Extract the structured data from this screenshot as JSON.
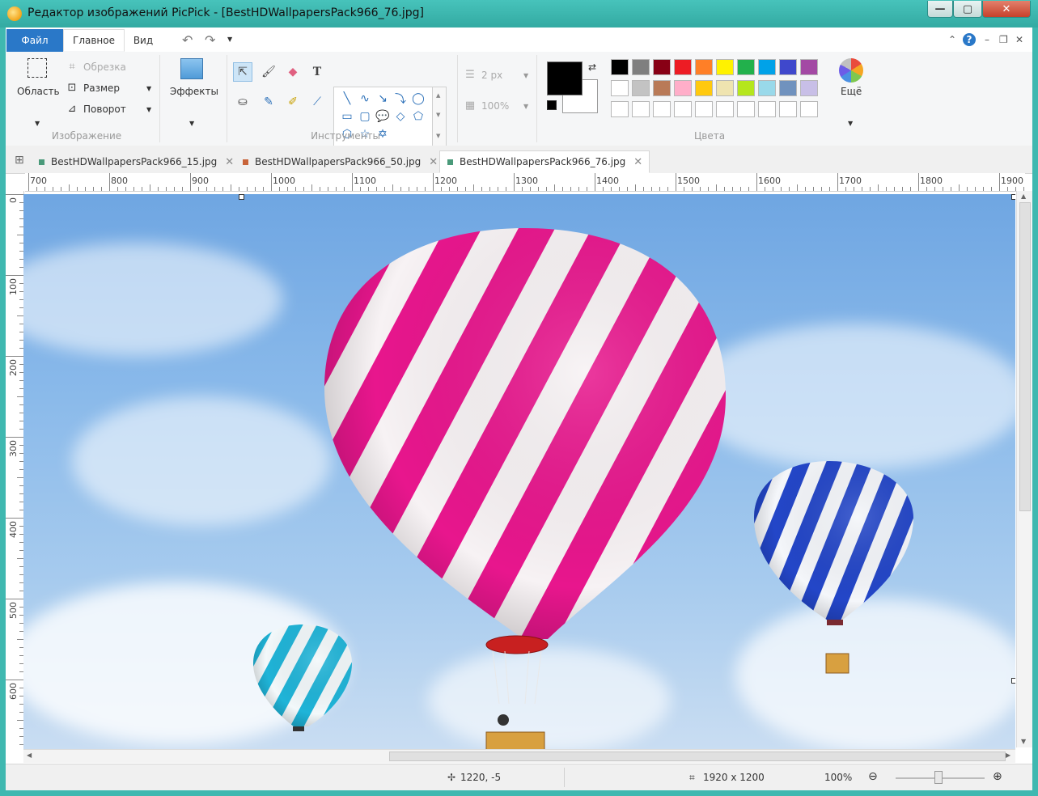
{
  "window": {
    "title": "Редактор изображений PicPick - [BestHDWallpapersPack966_76.jpg]"
  },
  "menu": {
    "file": "Файл",
    "tabs": [
      "Главное",
      "Вид"
    ]
  },
  "ribbon": {
    "image_group": {
      "label": "Изображение",
      "area": "Область",
      "crop": "Обрезка",
      "resize": "Размер",
      "rotate": "Поворот"
    },
    "effects_group": {
      "effects": "Эффекты"
    },
    "tools_group": {
      "label": "Инструменты"
    },
    "line_group": {
      "width": "2 px",
      "opacity": "100%"
    },
    "colors_group": {
      "label": "Цвета",
      "more": "Ещё",
      "primary": "#000000",
      "secondary": "#ffffff",
      "palette": [
        "#000000",
        "#7f7f7f",
        "#880015",
        "#ed1c24",
        "#ff7f27",
        "#fff200",
        "#22b14c",
        "#00a2e8",
        "#3f48cc",
        "#a349a4",
        "#ffffff",
        "#c3c3c3",
        "#b97a57",
        "#ffaec9",
        "#ffc90e",
        "#efe4b0",
        "#b5e61d",
        "#99d9ea",
        "#7092be",
        "#c8bfe7",
        "#ffffff",
        "#ffffff",
        "#ffffff",
        "#ffffff",
        "#ffffff",
        "#ffffff",
        "#ffffff",
        "#ffffff",
        "#ffffff",
        "#ffffff"
      ]
    }
  },
  "doc_tabs": [
    {
      "name": "BestHDWallpapersPack966_15.jpg",
      "color": "#4a9a7a"
    },
    {
      "name": "BestHDWallpapersPack966_50.jpg",
      "color": "#c8643a"
    },
    {
      "name": "BestHDWallpapersPack966_76.jpg",
      "color": "#4a9a7a"
    }
  ],
  "ruler": {
    "h_labels": [
      "700",
      "800",
      "900",
      "1000",
      "1100",
      "1200",
      "1300",
      "1400",
      "1500",
      "1600",
      "1700",
      "1800",
      "1900"
    ],
    "v_labels": [
      "0",
      "100",
      "200",
      "300",
      "400",
      "500",
      "600"
    ]
  },
  "status": {
    "cursor": "1220, -5",
    "size": "1920 x 1200",
    "zoom": "100%"
  }
}
